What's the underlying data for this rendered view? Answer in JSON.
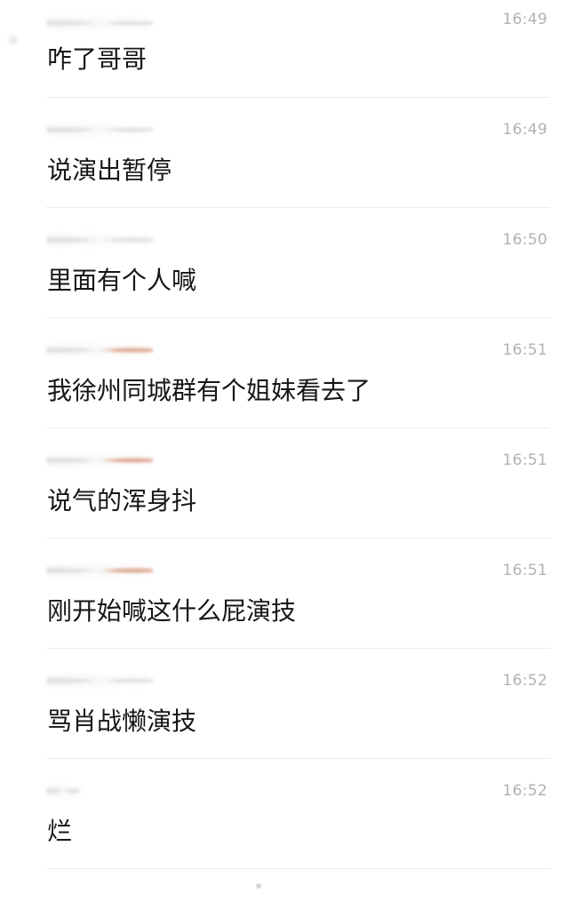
{
  "messages": [
    {
      "time": "16:49",
      "text": "咋了哥哥"
    },
    {
      "time": "16:49",
      "text": "说演出暂停"
    },
    {
      "time": "16:50",
      "text": "里面有个人喊"
    },
    {
      "time": "16:51",
      "text": "我徐州同城群有个姐妹看去了"
    },
    {
      "time": "16:51",
      "text": "说气的浑身抖"
    },
    {
      "time": "16:51",
      "text": "刚开始喊这什么屁演技"
    },
    {
      "time": "16:52",
      "text": "骂肖战懒演技"
    },
    {
      "time": "16:52",
      "text": "烂"
    }
  ]
}
